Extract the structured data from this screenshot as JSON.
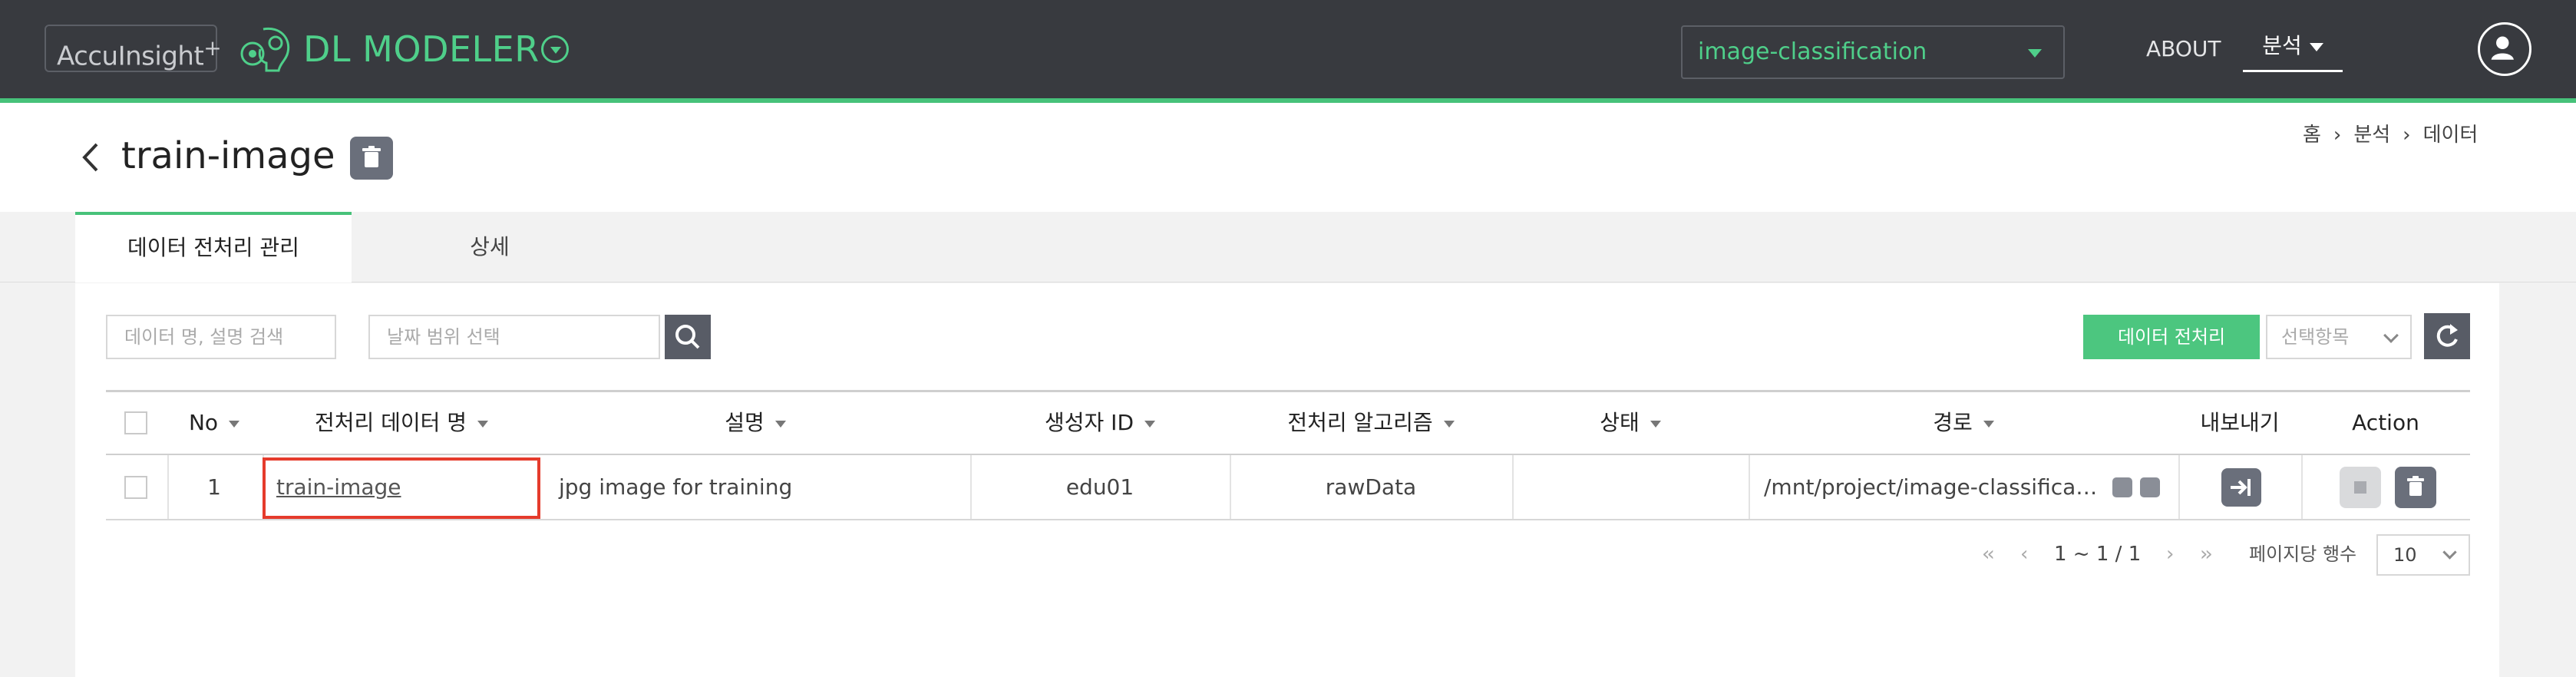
{
  "header": {
    "brand": "AccuInsight",
    "brand_plus": "+",
    "product": "DL MODELER",
    "project": "image-classification",
    "nav": {
      "about": "ABOUT",
      "analysis": "분석"
    }
  },
  "page": {
    "title": "train-image",
    "breadcrumb": [
      "홈",
      "분석",
      "데이터"
    ]
  },
  "tabs": [
    {
      "label": "데이터 전처리 관리",
      "active": true
    },
    {
      "label": "상세",
      "active": false
    }
  ],
  "toolbar": {
    "search_placeholder": "데이터 명, 설명 검색",
    "date_placeholder": "날짜 범위 선택",
    "preprocess_button": "데이터 전처리",
    "select_items": "선택항목"
  },
  "table": {
    "columns": [
      "No",
      "전처리 데이터 명",
      "설명",
      "생성자 ID",
      "전처리 알고리즘",
      "상태",
      "경로",
      "내보내기",
      "Action"
    ],
    "rows": [
      {
        "no": "1",
        "name": "train-image",
        "description": "jpg image for training",
        "creator": "edu01",
        "algorithm": "rawData",
        "status": "",
        "path": "/mnt/project/image-classification"
      }
    ]
  },
  "pagination": {
    "range": "1 ~ 1 / 1",
    "rows_per_page_label": "페이지당 행수",
    "rows_per_page": "10"
  },
  "colors": {
    "topbar": "#383a3f",
    "accent_green": "#47c27a",
    "highlight_red": "#e53b2c",
    "button_dark": "#585c66"
  }
}
